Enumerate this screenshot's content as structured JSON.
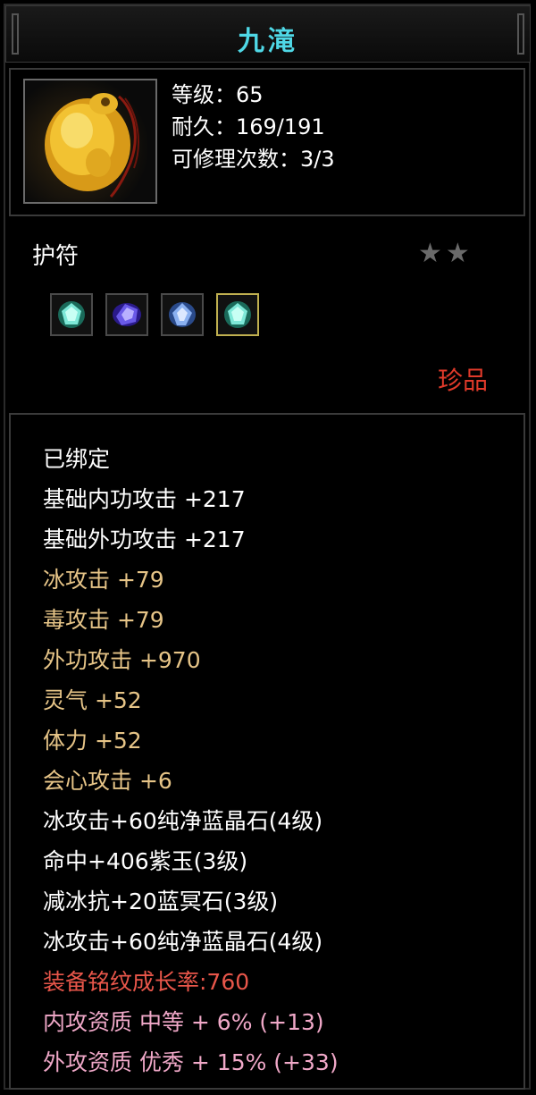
{
  "title": "九滝",
  "item": {
    "level_label": "等级：65",
    "durability_label": "耐久：169/191",
    "repair_label": "可修理次数：3/3",
    "icon": "amulet-icon"
  },
  "type": {
    "label": "护符",
    "stars": "★★",
    "rarity": "珍品"
  },
  "gems": [
    {
      "icon": "cyan-crystal-gem-icon"
    },
    {
      "icon": "purple-jade-gem-icon"
    },
    {
      "icon": "blue-crystal-gem-icon"
    },
    {
      "icon": "cyan-crystal-gem-icon"
    }
  ],
  "attributes": [
    {
      "text": "已绑定",
      "color": "#ffffff"
    },
    {
      "text": "基础内功攻击  +217",
      "color": "#ffffff"
    },
    {
      "text": "基础外功攻击  +217",
      "color": "#ffffff"
    },
    {
      "text": "冰攻击  +79",
      "color": "#e6c487"
    },
    {
      "text": "毒攻击  +79",
      "color": "#e6c487"
    },
    {
      "text": "外功攻击  +970",
      "color": "#e6c487"
    },
    {
      "text": "灵气  +52",
      "color": "#e6c487"
    },
    {
      "text": "体力  +52",
      "color": "#e6c487"
    },
    {
      "text": "会心攻击  +6",
      "color": "#e6c487"
    },
    {
      "text": "冰攻击+60纯净蓝晶石(4级)",
      "color": "#ffffff"
    },
    {
      "text": "命中+406紫玉(3级)",
      "color": "#ffffff"
    },
    {
      "text": "减冰抗+20蓝冥石(3级)",
      "color": "#ffffff"
    },
    {
      "text": "冰攻击+60纯净蓝晶石(4级)",
      "color": "#ffffff"
    },
    {
      "text": "装备铭纹成长率:760",
      "color": "#e8564a"
    },
    {
      "text": "内攻资质  中等  +  6%  (+13)",
      "color": "#f0a8c8"
    },
    {
      "text": "外攻资质  优秀  +  15%  (+33)",
      "color": "#f0a8c8"
    }
  ]
}
